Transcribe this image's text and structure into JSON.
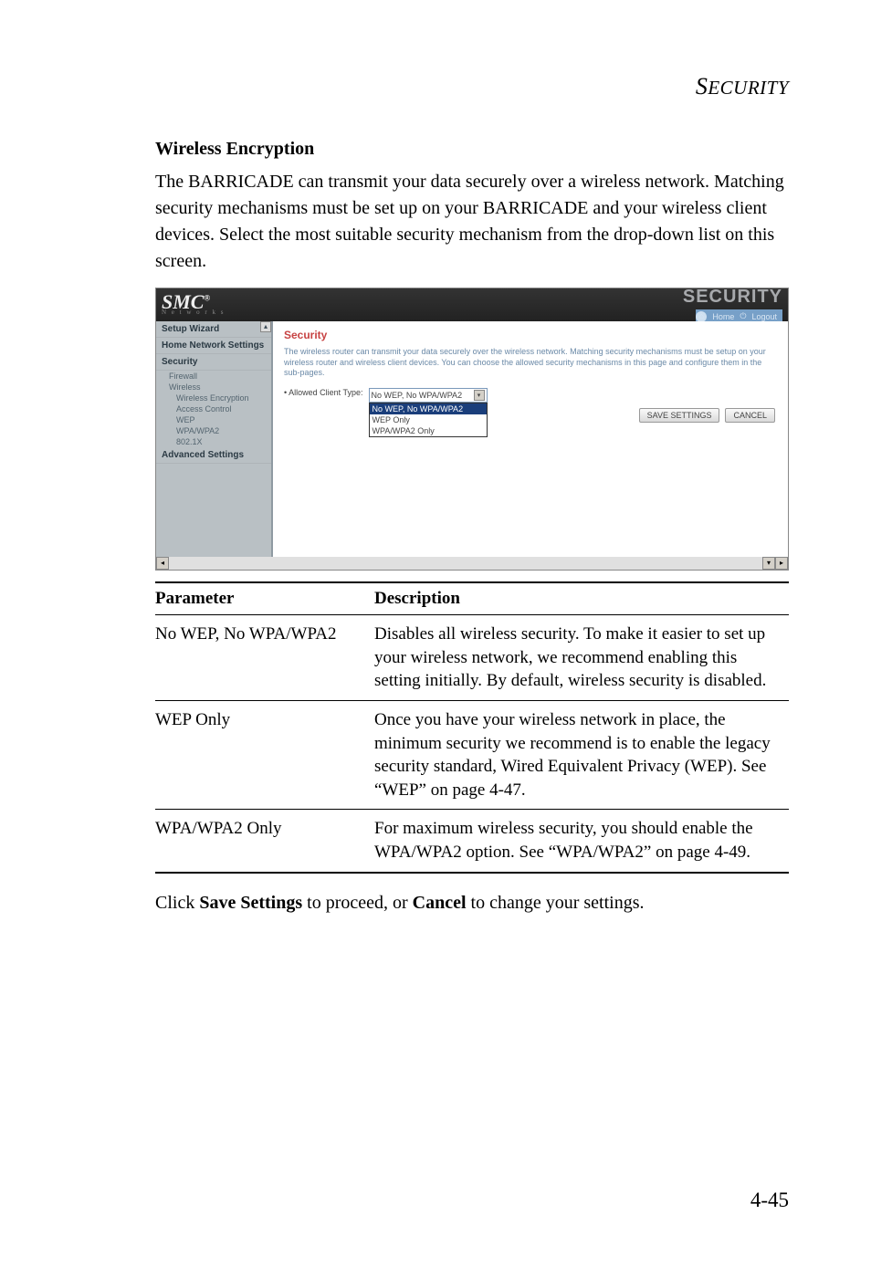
{
  "page_header": "SECURITY",
  "section_heading": "Wireless Encryption",
  "intro_para": "The BARRICADE can transmit your data securely over a wireless network. Matching security mechanisms must be set up on your BARRICADE and your wireless client devices. Select the most suitable security mechanism from the drop-down list on this screen.",
  "screenshot": {
    "logo": "SMC",
    "logo_reg": "®",
    "logo_sub": "N e t w o r k s",
    "top_title": "SECURITY",
    "homebar_home": "Home",
    "homebar_logout": "Logout",
    "home_icon_name": "home-icon",
    "power_icon_name": "power-icon",
    "sidebar": {
      "items": [
        {
          "label": "Setup Wizard",
          "bold": true
        },
        {
          "label": "Home Network Settings",
          "bold": true
        },
        {
          "label": "Security",
          "bold": true
        },
        {
          "label": "Firewall",
          "sub": true
        },
        {
          "label": "Wireless",
          "sub": true
        },
        {
          "label": "Wireless Encryption",
          "sub": true,
          "indent": 2
        },
        {
          "label": "Access Control",
          "sub": true,
          "indent": 2
        },
        {
          "label": "WEP",
          "sub": true,
          "indent": 2
        },
        {
          "label": "WPA/WPA2",
          "sub": true,
          "indent": 2
        },
        {
          "label": "802.1X",
          "sub": true,
          "indent": 2
        },
        {
          "label": "Advanced Settings",
          "bold": true
        }
      ]
    },
    "content": {
      "heading": "Security",
      "description": "The wireless router can transmit your data securely over the wireless network. Matching security mechanisms must be setup on your wireless router and wireless client devices. You can choose the allowed security mechanisms in this page and configure them in the sub-pages.",
      "label": "Allowed Client Type:",
      "selected": "No WEP, No WPA/WPA2",
      "options": [
        "No WEP, No WPA/WPA2",
        "WEP Only",
        "WPA/WPA2 Only"
      ],
      "save_btn": "SAVE SETTINGS",
      "cancel_btn": "CANCEL"
    }
  },
  "table": {
    "headers": [
      "Parameter",
      "Description"
    ],
    "rows": [
      {
        "param": "No WEP, No WPA/WPA2",
        "desc": "Disables all wireless security. To make it easier to set up your wireless network, we recommend enabling this setting initially. By default, wireless security is disabled."
      },
      {
        "param": "WEP Only",
        "desc": "Once you have your wireless network in place, the minimum security we recommend is to enable the legacy security standard, Wired Equivalent Privacy (WEP). See “WEP” on page 4-47."
      },
      {
        "param": "WPA/WPA2 Only",
        "desc": "For maximum wireless security, you should enable the WPA/WPA2 option. See “WPA/WPA2” on page 4-49."
      }
    ]
  },
  "closing_prefix": "Click ",
  "closing_bold1": "Save Settings",
  "closing_mid": " to proceed, or ",
  "closing_bold2": "Cancel",
  "closing_suffix": " to change your settings.",
  "page_number": "4-45"
}
